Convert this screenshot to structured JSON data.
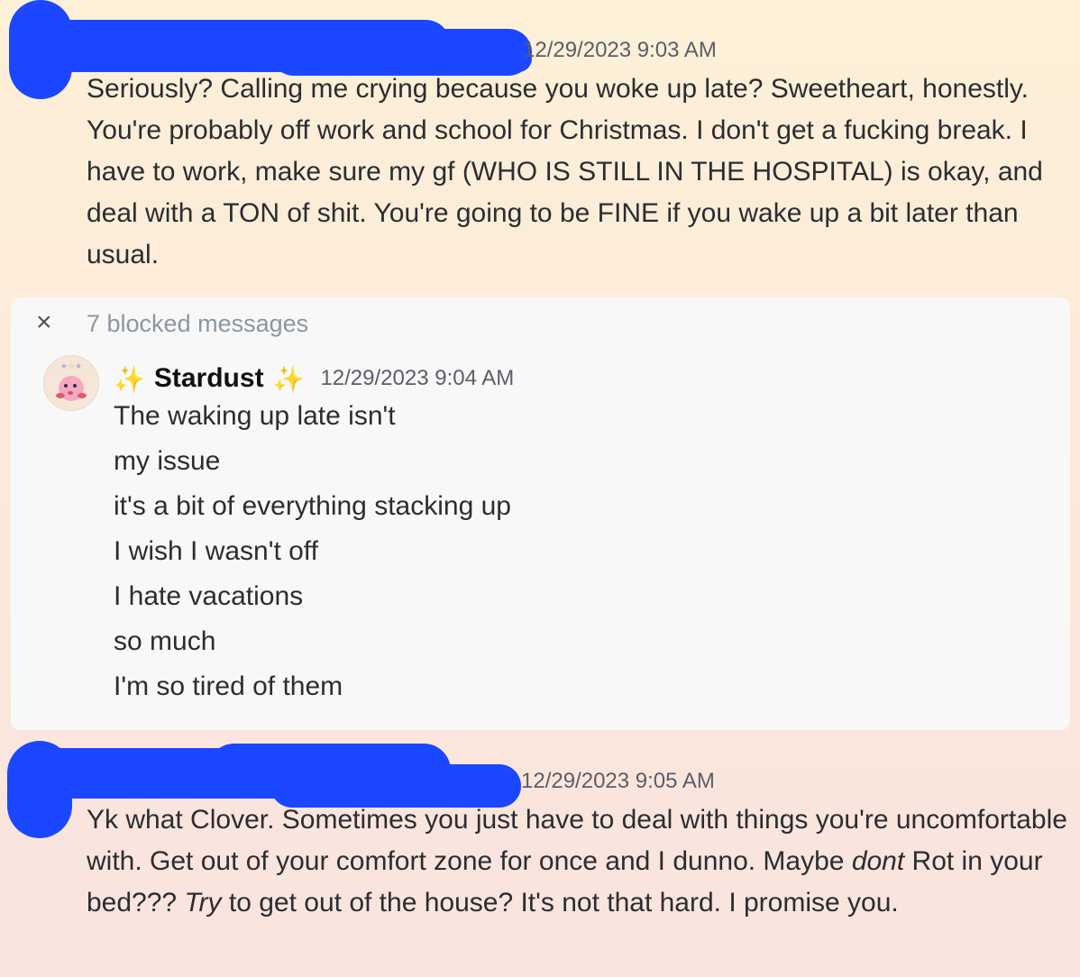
{
  "message1": {
    "timestamp": "12/29/2023 9:03 AM",
    "text": "Seriously? Calling me crying because you woke up late? Sweetheart, honestly. You're probably off work and school for Christmas. I don't get a fucking break. I have to work, make sure my gf (WHO IS STILL IN THE HOSPITAL) is okay, and deal with a TON of shit. You're going to be FINE if you wake up a bit later than usual."
  },
  "blocked": {
    "close_icon": "close-icon",
    "label": "7 blocked messages",
    "author": {
      "sparkle_left": "✨",
      "name": "Stardust",
      "sparkle_right": "✨",
      "timestamp": "12/29/2023 9:04 AM"
    },
    "lines": [
      "The waking up late isn't",
      "my issue",
      "it's a bit of everything stacking up",
      "I wish I wasn't off",
      "I hate vacations",
      "so much",
      "I'm so tired of them"
    ]
  },
  "message2": {
    "timestamp": "12/29/2023 9:05 AM",
    "part1": "Yk what Clover. Sometimes you just have to deal with things you're uncomfortable with. Get out of your comfort zone for once and I dunno. Maybe ",
    "em1": "dont",
    "part2": " Rot in your bed??? ",
    "em2": "Try",
    "part3": " to get out of the house? It's not that hard. I promise you."
  },
  "colors": {
    "redaction": "#1a47ff",
    "blocked_label": "#8a97a4",
    "timestamp": "#5c5e66"
  }
}
